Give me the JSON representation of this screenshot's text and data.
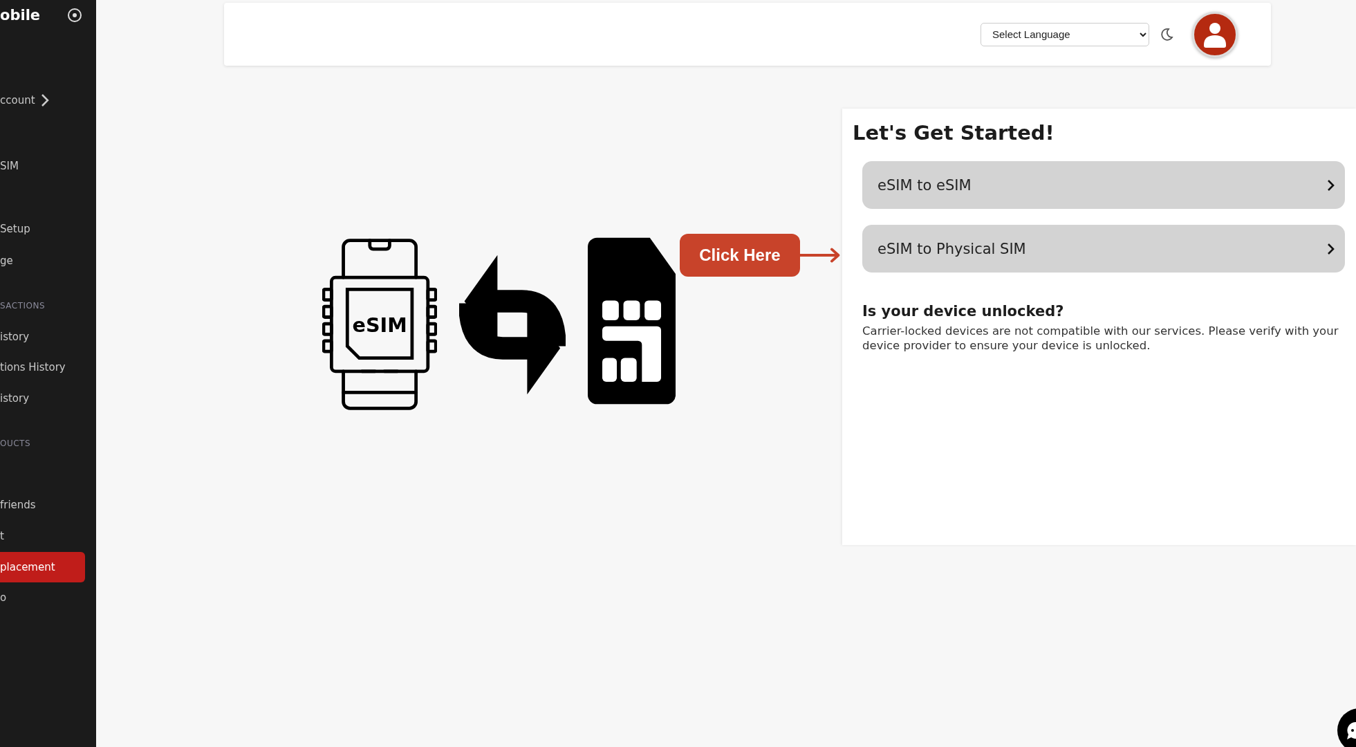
{
  "sidebar": {
    "brand": "obile",
    "items": [
      {
        "kind": "link",
        "label": "ccount",
        "expandable": true,
        "selected": false
      },
      {
        "kind": "link",
        "label": "SIM",
        "expandable": false,
        "selected": false
      },
      {
        "kind": "link",
        "label": "Setup",
        "expandable": false,
        "selected": false
      },
      {
        "kind": "link",
        "label": "ge",
        "expandable": false,
        "selected": false
      },
      {
        "kind": "section",
        "label": "SACTIONS"
      },
      {
        "kind": "link",
        "label": "istory",
        "expandable": false,
        "selected": false
      },
      {
        "kind": "link",
        "label": "tions History",
        "expandable": false,
        "selected": false
      },
      {
        "kind": "link",
        "label": "istory",
        "expandable": false,
        "selected": false
      },
      {
        "kind": "section",
        "label": "OUCTS"
      },
      {
        "kind": "link",
        "label": "friends",
        "expandable": false,
        "selected": false
      },
      {
        "kind": "link",
        "label": "t",
        "expandable": false,
        "selected": false
      },
      {
        "kind": "link",
        "label": "placement",
        "expandable": false,
        "selected": true
      },
      {
        "kind": "link",
        "label": "o",
        "expandable": false,
        "selected": false
      }
    ]
  },
  "header": {
    "language_select": "Select Language"
  },
  "illustration": {
    "chip_label": "eSIM",
    "callout": "Click Here"
  },
  "card": {
    "title": "Let's Get Started!",
    "options": [
      {
        "label": "eSIM to eSIM"
      },
      {
        "label": "eSIM to Physical SIM"
      }
    ],
    "notice_title": "Is your device unlocked?",
    "notice_text": "Carrier-locked devices are not compatible with our services. Please verify with your device provider to ensure your device is unlocked."
  }
}
